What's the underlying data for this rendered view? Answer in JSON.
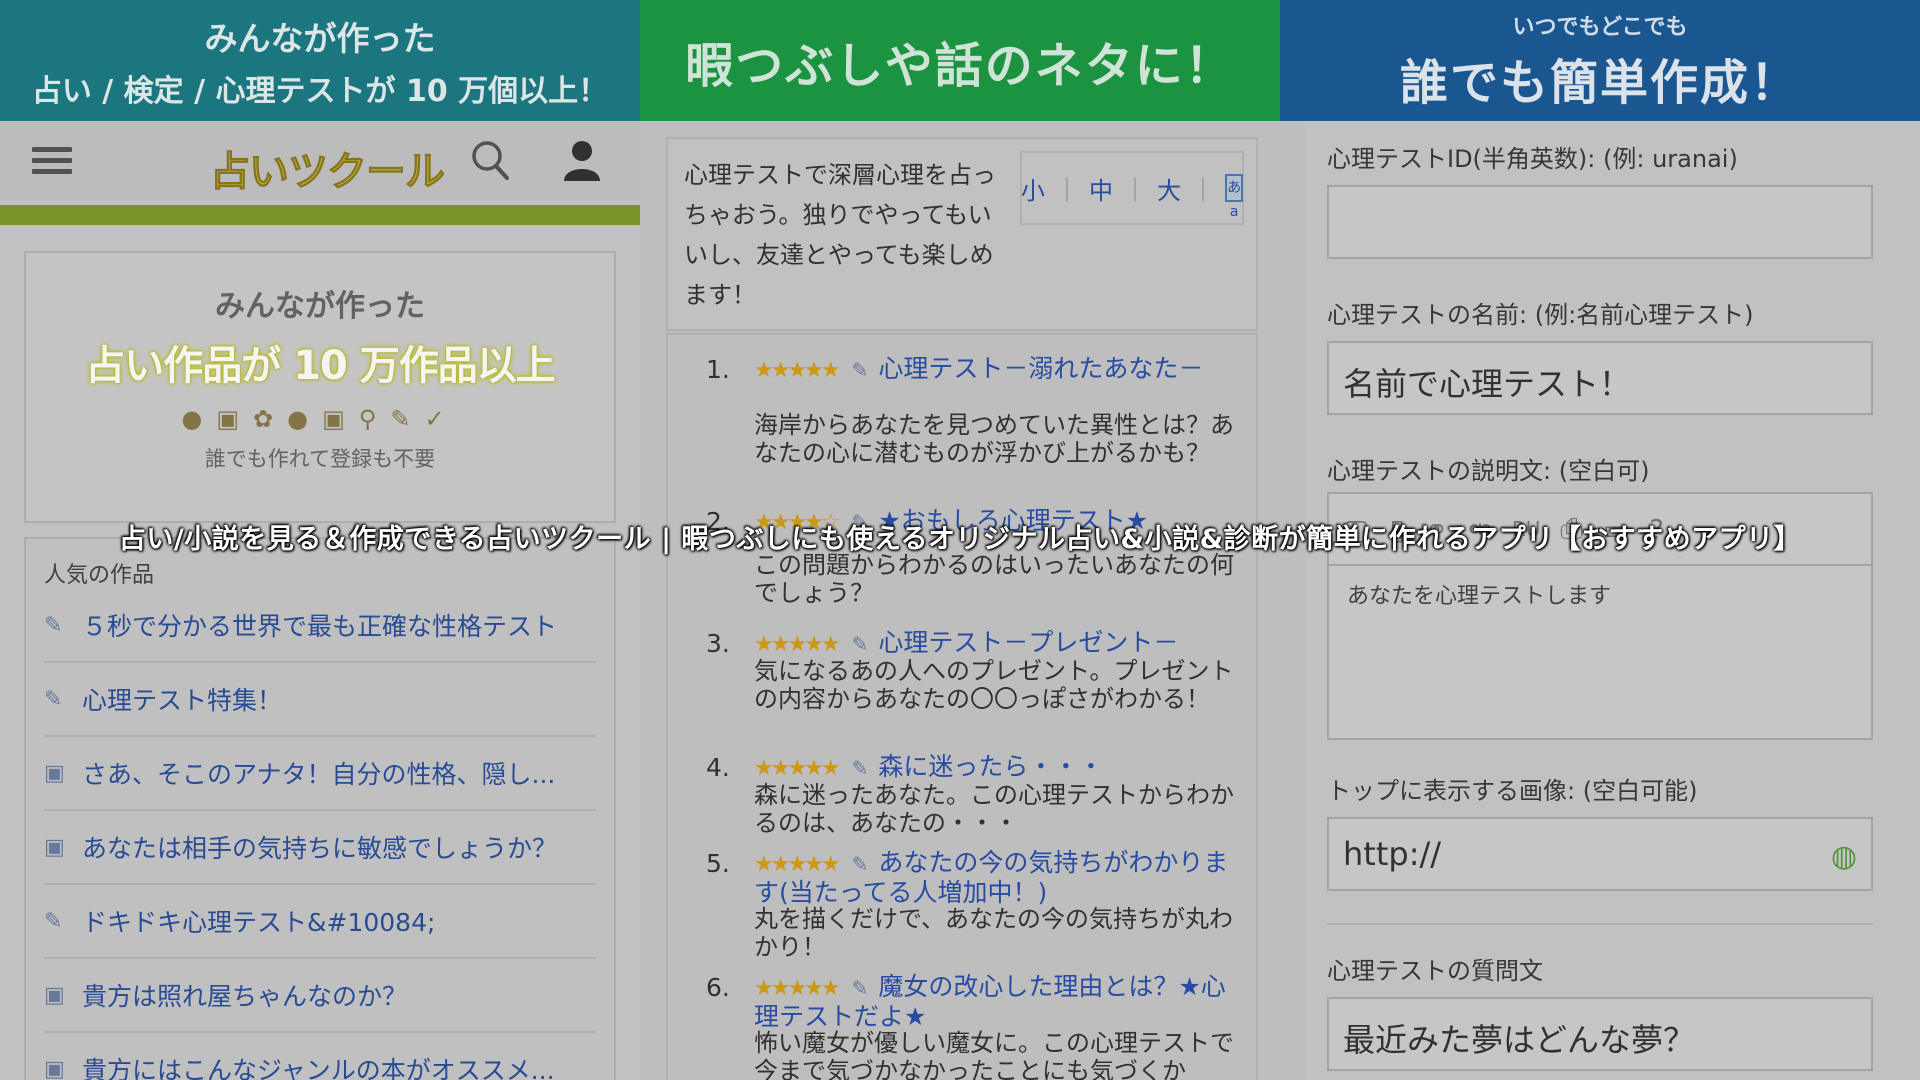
{
  "banners": {
    "left": {
      "line1": "みんなが作った",
      "line2": "占い / 検定 / 心理テストが 10 万個以上！"
    },
    "center": {
      "text": "暇つぶしや話のネタに！"
    },
    "right": {
      "small": "いつでもどこでも",
      "big": "誰でも簡単作成！"
    }
  },
  "left_panel": {
    "logo": "占いツクール",
    "promo": {
      "line1": "みんなが作った",
      "line2": "占い作品が 10 万作品以上",
      "line3": "誰でも作れて登録も不要"
    },
    "popular": {
      "title": "人気の作品",
      "items": [
        {
          "icon": "pen-icon",
          "label": "５秒で分かる世界で最も正確な性格テスト"
        },
        {
          "icon": "pen-icon",
          "label": "心理テスト特集！"
        },
        {
          "icon": "book-icon",
          "label": "さあ、そこのアナタ！自分の性格、隠し..."
        },
        {
          "icon": "book-icon",
          "label": "あなたは相手の気持ちに敏感でしょうか？"
        },
        {
          "icon": "pen-icon",
          "label": "ドキドキ心理テスト&#10084;"
        },
        {
          "icon": "book-icon",
          "label": "貴方は照れ屋ちゃんなのか？"
        },
        {
          "icon": "book-icon",
          "label": "貴方にはこんなジャンルの本がオススメ..."
        }
      ]
    }
  },
  "middle_panel": {
    "intro": "心理テストで深層心理を占っちゃおう。独りでやってもいいし、友達とやっても楽しめます！",
    "font_sizes": [
      "小",
      "中",
      "大"
    ],
    "list": [
      {
        "num": "1.",
        "rating": 4.5,
        "title": "心理テスト－溺れたあなた－",
        "desc": "海岸からあなたを見つめていた異性とは？あなたの心に潜むものが浮かび上がるかも？"
      },
      {
        "num": "2.",
        "rating": 4,
        "title": "★おもしろ心理テスト★",
        "desc": "この問題からわかるのはいったいあなたの何でしょう？"
      },
      {
        "num": "3.",
        "rating": 4.5,
        "title": "心理テスト－プレゼント－",
        "desc": "気になるあの人へのプレゼント。プレゼントの内容からあなたの〇〇っぽさがわかる！"
      },
      {
        "num": "4.",
        "rating": 4.5,
        "title": "森に迷ったら・・・",
        "desc": "森に迷ったあなた。この心理テストからわかるのは、あなたの・・・"
      },
      {
        "num": "5.",
        "rating": 4.5,
        "title": "あなたの今の気持ちがわかります(当たってる人増加中！)",
        "desc": "丸を描くだけで、あなたの今の気持ちが丸わかり！"
      },
      {
        "num": "6.",
        "rating": 4.5,
        "title": "魔女の改心した理由とは？★心理テストだよ★",
        "desc": "怖い魔女が優しい魔女に。この心理テストで今まで気づかなかったことにも気づくか"
      }
    ]
  },
  "right_panel": {
    "id_label": "心理テストID(半角英数): (例: uranai)",
    "id_value": "",
    "name_label": "心理テストの名前: (例:名前心理テスト)",
    "name_value": "名前で心理テスト！",
    "desc_label": "心理テストの説明文: (空白可)",
    "desc_value": "あなたを心理テストします",
    "image_label": "トップに表示する画像: (空白可能)",
    "image_value": "http://",
    "question_label": "心理テストの質問文",
    "question_value": "最近みた夢はどんな夢？"
  },
  "caption": "占い/小説を見る＆作成できる占いツクール | 暇つぶしにも使えるオリジナル占い&小説&診断が簡単に作れるアプリ【おすすめアプリ】"
}
